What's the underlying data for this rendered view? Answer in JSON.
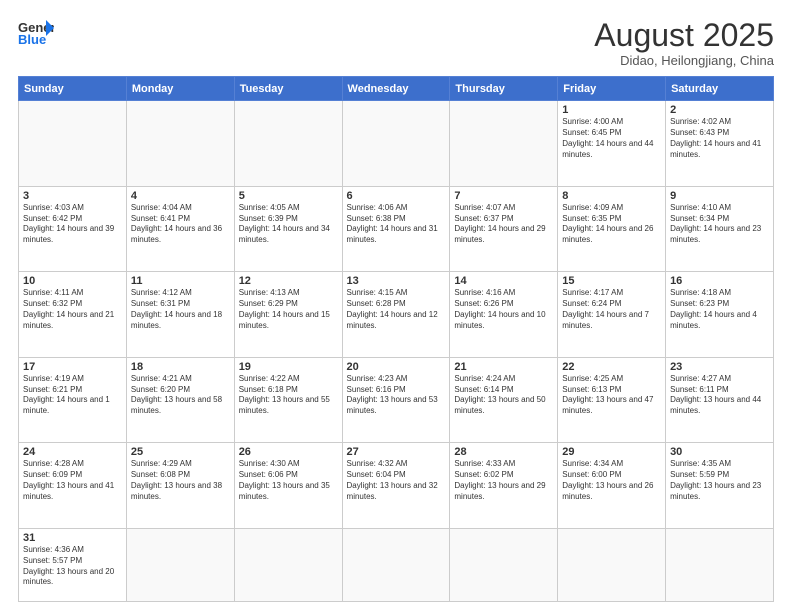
{
  "logo": {
    "text_general": "General",
    "text_blue": "Blue"
  },
  "title": "August 2025",
  "location": "Didao, Heilongjiang, China",
  "weekdays": [
    "Sunday",
    "Monday",
    "Tuesday",
    "Wednesday",
    "Thursday",
    "Friday",
    "Saturday"
  ],
  "weeks": [
    [
      {
        "num": "",
        "info": ""
      },
      {
        "num": "",
        "info": ""
      },
      {
        "num": "",
        "info": ""
      },
      {
        "num": "",
        "info": ""
      },
      {
        "num": "",
        "info": ""
      },
      {
        "num": "1",
        "info": "Sunrise: 4:00 AM\nSunset: 6:45 PM\nDaylight: 14 hours and 44 minutes."
      },
      {
        "num": "2",
        "info": "Sunrise: 4:02 AM\nSunset: 6:43 PM\nDaylight: 14 hours and 41 minutes."
      }
    ],
    [
      {
        "num": "3",
        "info": "Sunrise: 4:03 AM\nSunset: 6:42 PM\nDaylight: 14 hours and 39 minutes."
      },
      {
        "num": "4",
        "info": "Sunrise: 4:04 AM\nSunset: 6:41 PM\nDaylight: 14 hours and 36 minutes."
      },
      {
        "num": "5",
        "info": "Sunrise: 4:05 AM\nSunset: 6:39 PM\nDaylight: 14 hours and 34 minutes."
      },
      {
        "num": "6",
        "info": "Sunrise: 4:06 AM\nSunset: 6:38 PM\nDaylight: 14 hours and 31 minutes."
      },
      {
        "num": "7",
        "info": "Sunrise: 4:07 AM\nSunset: 6:37 PM\nDaylight: 14 hours and 29 minutes."
      },
      {
        "num": "8",
        "info": "Sunrise: 4:09 AM\nSunset: 6:35 PM\nDaylight: 14 hours and 26 minutes."
      },
      {
        "num": "9",
        "info": "Sunrise: 4:10 AM\nSunset: 6:34 PM\nDaylight: 14 hours and 23 minutes."
      }
    ],
    [
      {
        "num": "10",
        "info": "Sunrise: 4:11 AM\nSunset: 6:32 PM\nDaylight: 14 hours and 21 minutes."
      },
      {
        "num": "11",
        "info": "Sunrise: 4:12 AM\nSunset: 6:31 PM\nDaylight: 14 hours and 18 minutes."
      },
      {
        "num": "12",
        "info": "Sunrise: 4:13 AM\nSunset: 6:29 PM\nDaylight: 14 hours and 15 minutes."
      },
      {
        "num": "13",
        "info": "Sunrise: 4:15 AM\nSunset: 6:28 PM\nDaylight: 14 hours and 12 minutes."
      },
      {
        "num": "14",
        "info": "Sunrise: 4:16 AM\nSunset: 6:26 PM\nDaylight: 14 hours and 10 minutes."
      },
      {
        "num": "15",
        "info": "Sunrise: 4:17 AM\nSunset: 6:24 PM\nDaylight: 14 hours and 7 minutes."
      },
      {
        "num": "16",
        "info": "Sunrise: 4:18 AM\nSunset: 6:23 PM\nDaylight: 14 hours and 4 minutes."
      }
    ],
    [
      {
        "num": "17",
        "info": "Sunrise: 4:19 AM\nSunset: 6:21 PM\nDaylight: 14 hours and 1 minute."
      },
      {
        "num": "18",
        "info": "Sunrise: 4:21 AM\nSunset: 6:20 PM\nDaylight: 13 hours and 58 minutes."
      },
      {
        "num": "19",
        "info": "Sunrise: 4:22 AM\nSunset: 6:18 PM\nDaylight: 13 hours and 55 minutes."
      },
      {
        "num": "20",
        "info": "Sunrise: 4:23 AM\nSunset: 6:16 PM\nDaylight: 13 hours and 53 minutes."
      },
      {
        "num": "21",
        "info": "Sunrise: 4:24 AM\nSunset: 6:14 PM\nDaylight: 13 hours and 50 minutes."
      },
      {
        "num": "22",
        "info": "Sunrise: 4:25 AM\nSunset: 6:13 PM\nDaylight: 13 hours and 47 minutes."
      },
      {
        "num": "23",
        "info": "Sunrise: 4:27 AM\nSunset: 6:11 PM\nDaylight: 13 hours and 44 minutes."
      }
    ],
    [
      {
        "num": "24",
        "info": "Sunrise: 4:28 AM\nSunset: 6:09 PM\nDaylight: 13 hours and 41 minutes."
      },
      {
        "num": "25",
        "info": "Sunrise: 4:29 AM\nSunset: 6:08 PM\nDaylight: 13 hours and 38 minutes."
      },
      {
        "num": "26",
        "info": "Sunrise: 4:30 AM\nSunset: 6:06 PM\nDaylight: 13 hours and 35 minutes."
      },
      {
        "num": "27",
        "info": "Sunrise: 4:32 AM\nSunset: 6:04 PM\nDaylight: 13 hours and 32 minutes."
      },
      {
        "num": "28",
        "info": "Sunrise: 4:33 AM\nSunset: 6:02 PM\nDaylight: 13 hours and 29 minutes."
      },
      {
        "num": "29",
        "info": "Sunrise: 4:34 AM\nSunset: 6:00 PM\nDaylight: 13 hours and 26 minutes."
      },
      {
        "num": "30",
        "info": "Sunrise: 4:35 AM\nSunset: 5:59 PM\nDaylight: 13 hours and 23 minutes."
      }
    ],
    [
      {
        "num": "31",
        "info": "Sunrise: 4:36 AM\nSunset: 5:57 PM\nDaylight: 13 hours and 20 minutes."
      },
      {
        "num": "",
        "info": ""
      },
      {
        "num": "",
        "info": ""
      },
      {
        "num": "",
        "info": ""
      },
      {
        "num": "",
        "info": ""
      },
      {
        "num": "",
        "info": ""
      },
      {
        "num": "",
        "info": ""
      }
    ]
  ]
}
